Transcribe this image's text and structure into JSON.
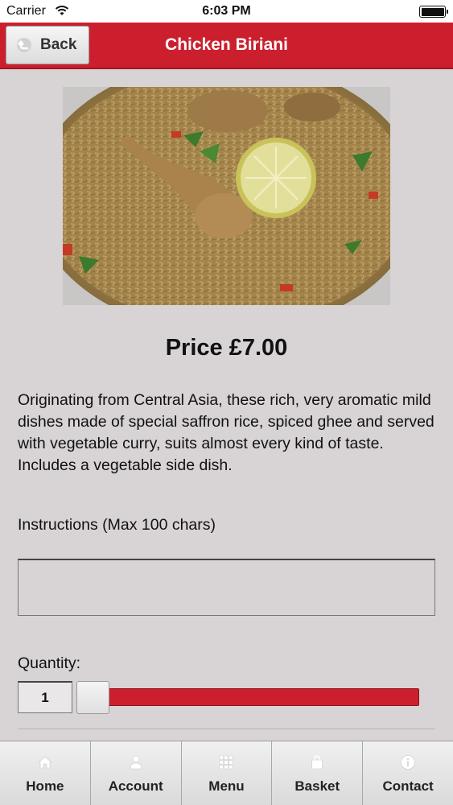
{
  "status_bar": {
    "carrier": "Carrier",
    "time": "6:03 PM"
  },
  "nav": {
    "back_label": "Back",
    "title": "Chicken Biriani"
  },
  "product": {
    "price": "Price £7.00",
    "description": "Originating from Central Asia, these rich, very aromatic mild dishes made of special saffron rice, spiced ghee and served with vegetable curry, suits almost every kind of taste. Includes a vegetable side dish."
  },
  "instructions": {
    "label": "Instructions (Max 100 chars)",
    "value": ""
  },
  "quantity": {
    "label": "Quantity:",
    "value": "1",
    "slider_fraction": 0.0
  },
  "tabs": [
    {
      "label": "Home",
      "icon": "home-icon"
    },
    {
      "label": "Account",
      "icon": "user-icon"
    },
    {
      "label": "Menu",
      "icon": "grid-icon"
    },
    {
      "label": "Basket",
      "icon": "basket-icon"
    },
    {
      "label": "Contact",
      "icon": "info-icon"
    }
  ],
  "colors": {
    "accent": "#cc1f2e",
    "background": "#d8d3d5"
  }
}
